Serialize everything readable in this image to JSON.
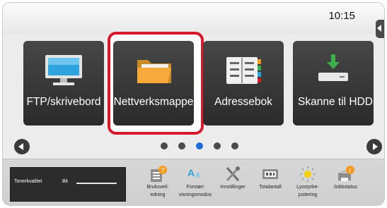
{
  "status_bar": {
    "time": "10:15"
  },
  "tiles": [
    {
      "label": "FTP/skrivebord"
    },
    {
      "label": "Nettverksmappe"
    },
    {
      "label": "Adressebok"
    },
    {
      "label": "Skanne til HDD"
    }
  ],
  "pagination": {
    "pages": 5,
    "active_page": 3
  },
  "toner": {
    "label": "Tonerkvalitet",
    "color_label": "Bk"
  },
  "bottom_icons": [
    {
      "label_line1": "Bruksveil-",
      "label_line2": "edning"
    },
    {
      "label_line1": "Forstørr",
      "label_line2": "visningsmodus"
    },
    {
      "label_line1": "Innstillinger",
      "label_line2": ""
    },
    {
      "label_line1": "Totalantall",
      "label_line2": ""
    },
    {
      "label_line1": "Lysstyrke-",
      "label_line2": "justering"
    },
    {
      "label_line1": "Jobbstatus",
      "label_line2": ""
    }
  ],
  "colors": {
    "highlight": "#d7192b",
    "active_dot": "#1e6fd9",
    "tile_bg": "#333333",
    "accent_orange": "#f39a1f"
  }
}
